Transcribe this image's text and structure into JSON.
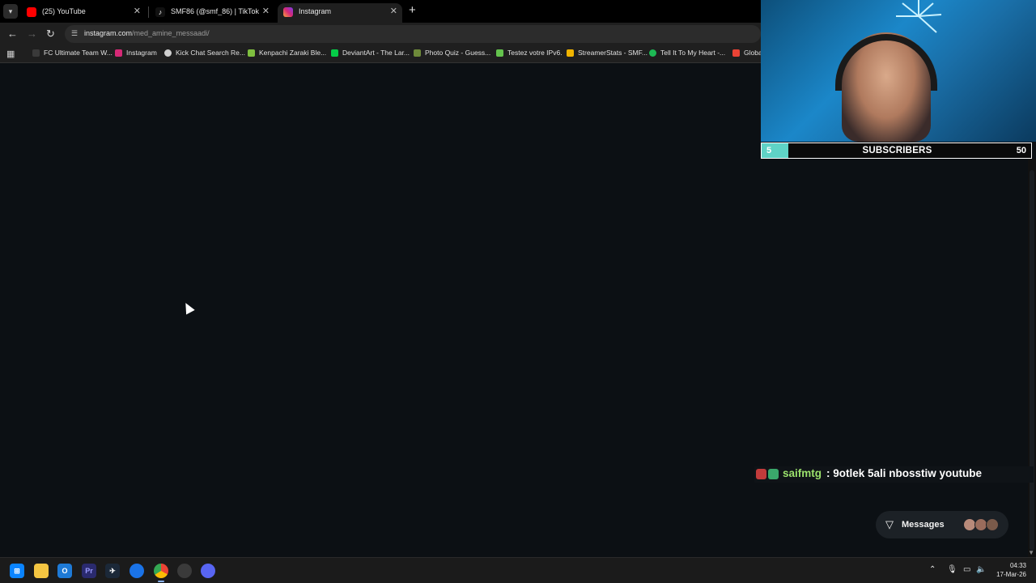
{
  "browser": {
    "tabs": [
      {
        "title": "(25) YouTube",
        "icon": "youtube-icon",
        "color": "#ff0000"
      },
      {
        "title": "SMF86 (@smf_86) | TikTok",
        "icon": "tiktok-icon",
        "color": "#111111"
      },
      {
        "title": "Instagram",
        "icon": "instagram-icon",
        "color": "#d62976",
        "active": true
      }
    ],
    "url_domain": "instagram.com",
    "url_path": "/med_amine_messaadi/",
    "bookmarks": [
      {
        "label": "FC Ultimate Team W...",
        "icon": "fc-icon"
      },
      {
        "label": "Instagram",
        "icon": "instagram-icon"
      },
      {
        "label": "Kick Chat Search Re...",
        "icon": "kick-icon"
      },
      {
        "label": "Kenpachi Zaraki Ble...",
        "icon": "link-icon"
      },
      {
        "label": "DeviantArt - The Lar...",
        "icon": "deviantart-icon"
      },
      {
        "label": "Photo Quiz - Guess...",
        "icon": "quiz-icon"
      },
      {
        "label": "Testez votre IPv6.",
        "icon": "ipv6-icon"
      },
      {
        "label": "StreamerStats - SMF...",
        "icon": "stats-icon"
      },
      {
        "label": "Tell It To My Heart -...",
        "icon": "spotify-icon"
      },
      {
        "label": "Globa",
        "icon": "google-icon"
      }
    ]
  },
  "overlay": {
    "subs_current": "5",
    "subs_label": "SUBSCRIBERS",
    "subs_goal": "50",
    "subs_progress": 0.1,
    "subs_fill_color": "#5fd3c6",
    "chat_user": "saifmtg",
    "chat_message": ": 9otlek 5ali nbosstiw youtube",
    "messages_label": "Messages"
  },
  "taskbar": {
    "time": "04:33",
    "date": "17-Mar-26"
  }
}
